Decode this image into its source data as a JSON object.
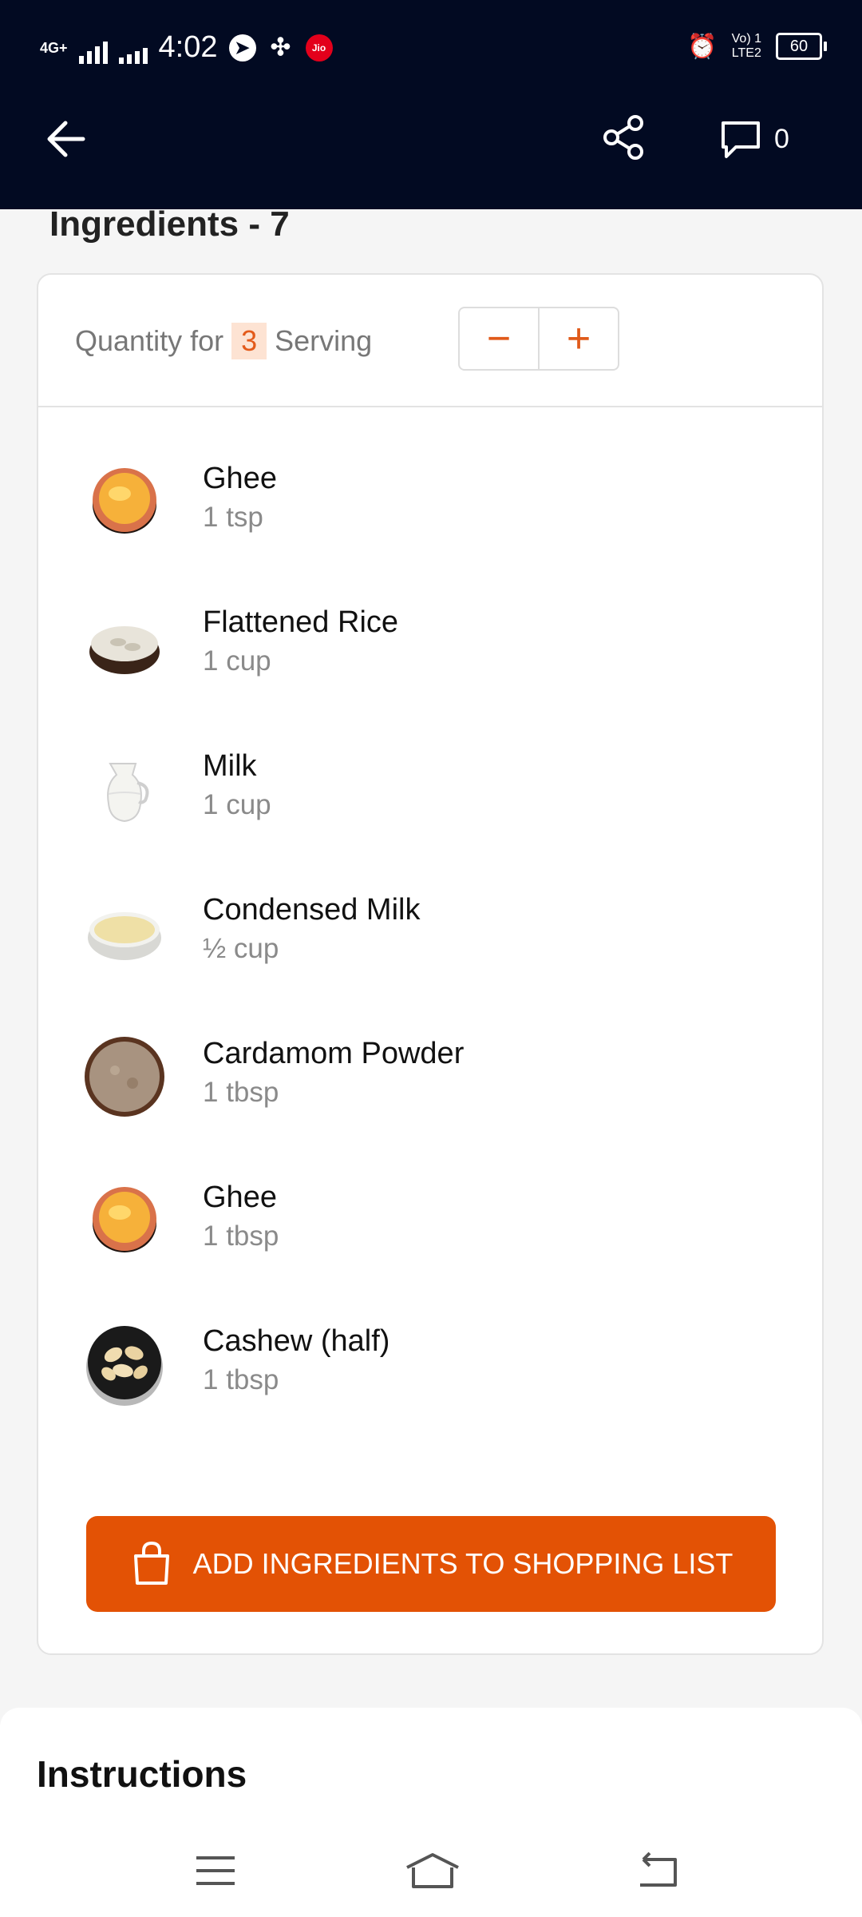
{
  "status_bar": {
    "network_left": "4G+",
    "time": "4:02",
    "volte": "Vo) 1",
    "lte": "LTE2",
    "battery": "60"
  },
  "app_bar": {
    "comment_count": "0"
  },
  "ingredients": {
    "heading": "Ingredients -  7",
    "quantity_prefix": "Quantity for",
    "servings": "3",
    "quantity_suffix": "Serving",
    "minus": "−",
    "plus": "+",
    "items": [
      {
        "name": "Ghee",
        "amount": "1 tsp",
        "icon": "ghee-bowl"
      },
      {
        "name": "Flattened Rice",
        "amount": "1 cup",
        "icon": "flattened-rice-bowl"
      },
      {
        "name": "Milk",
        "amount": "1 cup",
        "icon": "milk-jug"
      },
      {
        "name": "Condensed Milk",
        "amount": "½ cup",
        "icon": "condensed-milk-bowl"
      },
      {
        "name": "Cardamom Powder",
        "amount": "1 tbsp",
        "icon": "cardamom-powder-bowl"
      },
      {
        "name": "Ghee",
        "amount": "1 tbsp",
        "icon": "ghee-bowl"
      },
      {
        "name": "Cashew (half)",
        "amount": "1 tbsp",
        "icon": "cashew-bowl"
      }
    ],
    "add_button": "ADD INGREDIENTS TO SHOPPING LIST"
  },
  "instructions": {
    "heading": "Instructions"
  },
  "colors": {
    "header_bg": "#020a22",
    "accent": "#e35205"
  }
}
